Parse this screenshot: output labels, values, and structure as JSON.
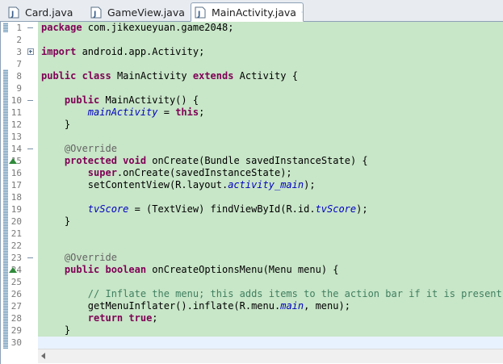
{
  "tabs": [
    {
      "label": "Card.java",
      "active": false
    },
    {
      "label": "GameView.java",
      "active": false
    },
    {
      "label": "MainActivity.java",
      "active": true
    }
  ],
  "editor": {
    "background_color": "#c8e6c8",
    "lines": [
      {
        "number": "1",
        "fold": "minus",
        "tokens": [
          {
            "t": "kw",
            "s": "package"
          },
          {
            "t": "txt",
            "s": " com.jikexueyuan.game2048;"
          }
        ]
      },
      {
        "number": "2",
        "tokens": []
      },
      {
        "number": "3",
        "fold": "plus",
        "tokens": [
          {
            "t": "kw",
            "s": "import"
          },
          {
            "t": "txt",
            "s": " android.app.Activity;"
          }
        ]
      },
      {
        "number": "7",
        "tokens": []
      },
      {
        "number": "8",
        "tokens": [
          {
            "t": "kw",
            "s": "public"
          },
          {
            "t": "txt",
            "s": " "
          },
          {
            "t": "kw",
            "s": "class"
          },
          {
            "t": "txt",
            "s": " MainActivity "
          },
          {
            "t": "kw",
            "s": "extends"
          },
          {
            "t": "txt",
            "s": " Activity {"
          }
        ]
      },
      {
        "number": "9",
        "tokens": []
      },
      {
        "number": "10",
        "fold": "minus",
        "tokens": [
          {
            "t": "txt",
            "s": "    "
          },
          {
            "t": "kw",
            "s": "public"
          },
          {
            "t": "txt",
            "s": " MainActivity() {"
          }
        ]
      },
      {
        "number": "11",
        "tokens": [
          {
            "t": "txt",
            "s": "        "
          },
          {
            "t": "fld",
            "s": "mainActivity"
          },
          {
            "t": "txt",
            "s": " = "
          },
          {
            "t": "kw",
            "s": "this"
          },
          {
            "t": "txt",
            "s": ";"
          }
        ]
      },
      {
        "number": "12",
        "tokens": [
          {
            "t": "txt",
            "s": "    }"
          }
        ]
      },
      {
        "number": "13",
        "tokens": []
      },
      {
        "number": "14",
        "fold": "minus",
        "tokens": [
          {
            "t": "txt",
            "s": "    "
          },
          {
            "t": "ann",
            "s": "@Override"
          }
        ]
      },
      {
        "number": "15",
        "override": true,
        "tokens": [
          {
            "t": "txt",
            "s": "    "
          },
          {
            "t": "kw",
            "s": "protected"
          },
          {
            "t": "txt",
            "s": " "
          },
          {
            "t": "kw",
            "s": "void"
          },
          {
            "t": "txt",
            "s": " onCreate(Bundle savedInstanceState) {"
          }
        ]
      },
      {
        "number": "16",
        "tokens": [
          {
            "t": "txt",
            "s": "        "
          },
          {
            "t": "kw",
            "s": "super"
          },
          {
            "t": "txt",
            "s": ".onCreate(savedInstanceState);"
          }
        ]
      },
      {
        "number": "17",
        "tokens": [
          {
            "t": "txt",
            "s": "        setContentView(R.layout."
          },
          {
            "t": "fld",
            "s": "activity_main"
          },
          {
            "t": "txt",
            "s": ");"
          }
        ]
      },
      {
        "number": "18",
        "tokens": []
      },
      {
        "number": "19",
        "tokens": [
          {
            "t": "txt",
            "s": "        "
          },
          {
            "t": "fld2",
            "s": "tvScore"
          },
          {
            "t": "txt",
            "s": " = (TextView) findViewById(R.id."
          },
          {
            "t": "fld",
            "s": "tvScore"
          },
          {
            "t": "txt",
            "s": ");"
          }
        ]
      },
      {
        "number": "20",
        "tokens": [
          {
            "t": "txt",
            "s": "    }"
          }
        ]
      },
      {
        "number": "21",
        "tokens": []
      },
      {
        "number": "22",
        "tokens": []
      },
      {
        "number": "23",
        "fold": "minus",
        "tokens": [
          {
            "t": "txt",
            "s": "    "
          },
          {
            "t": "ann",
            "s": "@Override"
          }
        ]
      },
      {
        "number": "24",
        "override": true,
        "tokens": [
          {
            "t": "txt",
            "s": "    "
          },
          {
            "t": "kw",
            "s": "public"
          },
          {
            "t": "txt",
            "s": " "
          },
          {
            "t": "kw",
            "s": "boolean"
          },
          {
            "t": "txt",
            "s": " onCreateOptionsMenu(Menu menu) {"
          }
        ]
      },
      {
        "number": "25",
        "tokens": []
      },
      {
        "number": "26",
        "tokens": [
          {
            "t": "txt",
            "s": "        "
          },
          {
            "t": "cmt",
            "s": "// Inflate the menu; this adds items to the action bar if it is present."
          }
        ]
      },
      {
        "number": "27",
        "tokens": [
          {
            "t": "txt",
            "s": "        getMenuInflater().inflate(R.menu."
          },
          {
            "t": "fld",
            "s": "main"
          },
          {
            "t": "txt",
            "s": ", menu);"
          }
        ]
      },
      {
        "number": "28",
        "tokens": [
          {
            "t": "txt",
            "s": "        "
          },
          {
            "t": "kw",
            "s": "return"
          },
          {
            "t": "txt",
            "s": " "
          },
          {
            "t": "kw",
            "s": "true"
          },
          {
            "t": "txt",
            "s": ";"
          }
        ]
      },
      {
        "number": "29",
        "tokens": [
          {
            "t": "txt",
            "s": "    }"
          }
        ]
      },
      {
        "number": "30",
        "current": true,
        "tokens": []
      }
    ]
  }
}
